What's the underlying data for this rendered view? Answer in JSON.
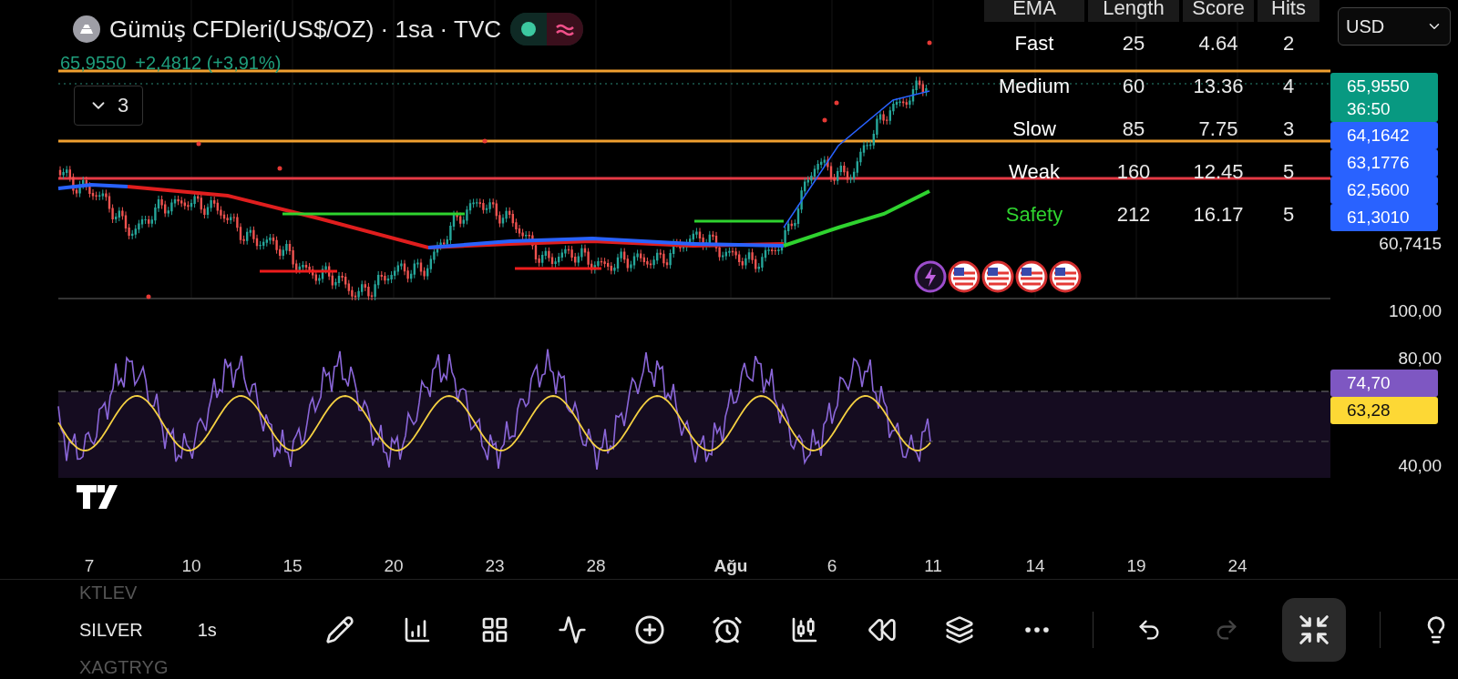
{
  "header": {
    "title": "Gümüş CFDleri(US$/OZ) · 1sa · TVC",
    "market_open": true,
    "price": "65,9550",
    "change": "+2,4812 (+3,91%)"
  },
  "legend_toggle": {
    "count": "3",
    "expanded": false
  },
  "currency": {
    "value": "USD"
  },
  "ema_table": {
    "columns": [
      "EMA",
      "Length",
      "Score",
      "Hits"
    ],
    "rows": [
      {
        "name": "Fast",
        "length": "25",
        "score": "4.64",
        "hits": "2",
        "color": "#ffffff"
      },
      {
        "name": "Medium",
        "length": "60",
        "score": "13.36",
        "hits": "4",
        "color": "#ffffff"
      },
      {
        "name": "Slow",
        "length": "85",
        "score": "7.75",
        "hits": "3",
        "color": "#ffffff"
      },
      {
        "name": "Weak",
        "length": "160",
        "score": "12.45",
        "hits": "5",
        "color": "#ffffff"
      },
      {
        "name": "Safety",
        "length": "212",
        "score": "16.17",
        "hits": "5",
        "color": "#2fd32f"
      }
    ]
  },
  "price_axis": [
    {
      "text": "65,9550",
      "sub": "36:50",
      "kind": "badge",
      "color": "#089981"
    },
    {
      "text": "64,1642",
      "kind": "badge",
      "color": "#2962ff"
    },
    {
      "text": "63,1776",
      "kind": "badge",
      "color": "#2962ff"
    },
    {
      "text": "62,5600",
      "kind": "badge",
      "color": "#2962ff"
    },
    {
      "text": "61,3010",
      "kind": "badge",
      "color": "#2962ff"
    },
    {
      "text": "60,7415",
      "kind": "plain"
    }
  ],
  "rsi_axis": [
    {
      "text": "100,00",
      "kind": "plain"
    },
    {
      "text": "80,00",
      "kind": "plain"
    },
    {
      "text": "74,70",
      "kind": "badge",
      "color": "#7e57c2"
    },
    {
      "text": "63,28",
      "kind": "badge",
      "color": "#fdd835"
    },
    {
      "text": "40,00",
      "kind": "plain"
    }
  ],
  "time_axis": [
    {
      "label": "7",
      "bold": false
    },
    {
      "label": "10",
      "bold": false
    },
    {
      "label": "15",
      "bold": false
    },
    {
      "label": "20",
      "bold": false
    },
    {
      "label": "23",
      "bold": false
    },
    {
      "label": "28",
      "bold": false
    },
    {
      "label": "Ağu",
      "bold": true
    },
    {
      "label": "6",
      "bold": false
    },
    {
      "label": "11",
      "bold": false
    },
    {
      "label": "14",
      "bold": false
    },
    {
      "label": "19",
      "bold": false
    },
    {
      "label": "24",
      "bold": false
    }
  ],
  "symbols": [
    {
      "text": "KTLEV",
      "selected": false
    },
    {
      "text": "SILVER",
      "interval": "1s",
      "selected": true
    },
    {
      "text": "XAGTRYG",
      "selected": false
    }
  ],
  "history": {
    "undo_disabled": false,
    "redo_disabled": true
  },
  "fullscreen_toggle": {
    "on": true
  }
}
